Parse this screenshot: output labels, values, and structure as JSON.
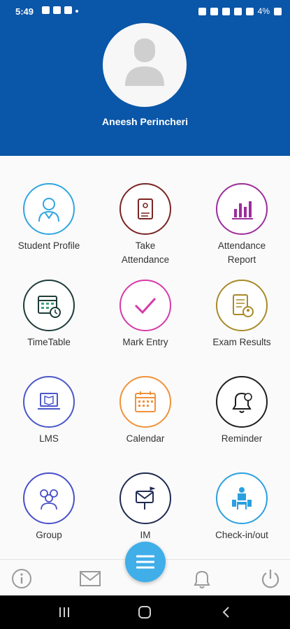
{
  "status_bar": {
    "time": "5:49",
    "battery": "4%"
  },
  "profile": {
    "name": "Aneesh Perincheri"
  },
  "menu": [
    {
      "label": "Student Profile",
      "icon": "student-profile-icon",
      "color": "#2fa6e0"
    },
    {
      "label": "Take\nAttendance",
      "icon": "take-attendance-icon",
      "color": "#7b2525"
    },
    {
      "label": "Attendance\nReport",
      "icon": "attendance-report-icon",
      "color": "#9c2d9c"
    },
    {
      "label": "TimeTable",
      "icon": "timetable-icon",
      "color": "#1f3c3a"
    },
    {
      "label": "Mark Entry",
      "icon": "mark-entry-icon",
      "color": "#d63aa9"
    },
    {
      "label": "Exam Results",
      "icon": "exam-results-icon",
      "color": "#a88a28"
    },
    {
      "label": "LMS",
      "icon": "lms-icon",
      "color": "#4a58c9"
    },
    {
      "label": "Calendar",
      "icon": "calendar-icon",
      "color": "#f0923a"
    },
    {
      "label": "Reminder",
      "icon": "reminder-icon",
      "color": "#1e1e1e"
    },
    {
      "label": "Group",
      "icon": "group-icon",
      "color": "#4a4fc9"
    },
    {
      "label": "IM",
      "icon": "im-icon",
      "color": "#1f2b52"
    },
    {
      "label": "Check-in/out",
      "icon": "check-in-out-icon",
      "color": "#2aa0e0"
    }
  ],
  "bottom_nav": [
    "info-icon",
    "mail-icon",
    "menu-icon",
    "bell-icon",
    "power-icon"
  ],
  "colors": {
    "header": "#0a56a8",
    "fab": "#40aee8"
  }
}
